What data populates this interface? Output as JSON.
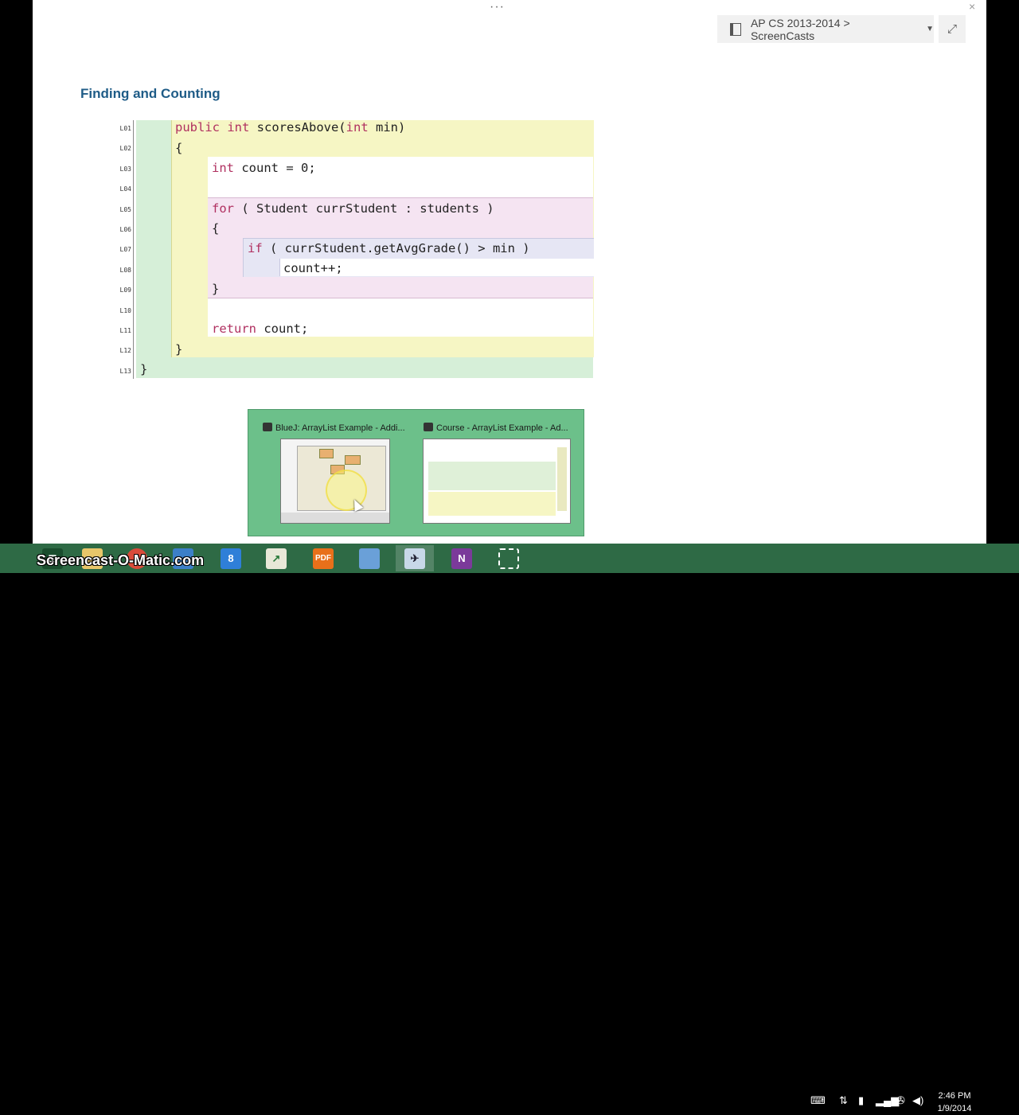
{
  "topbar": {
    "more": "···",
    "close": "×",
    "breadcrumb": "AP CS 2013-2014 > ScreenCasts",
    "fullscreen": "⤢"
  },
  "page": {
    "title": "Finding and Counting"
  },
  "code": {
    "line_numbers": [
      "L01",
      "L02",
      "L03",
      "L04",
      "L05",
      "L06",
      "L07",
      "L08",
      "L09",
      "L10",
      "L11",
      "L12",
      "L13"
    ],
    "lines": [
      {
        "kw": "public int",
        "text": " scoresAbove(",
        "kw2": "int",
        "text2": " min)"
      },
      {
        "text": "{"
      },
      {
        "kw": "int",
        "text": " count = 0;"
      },
      {
        "text": ""
      },
      {
        "kw": "for",
        "text": " ( Student currStudent : students )"
      },
      {
        "text": "{"
      },
      {
        "kw": "if",
        "text": " ( currStudent.getAvgGrade() > min )"
      },
      {
        "text": "count++;"
      },
      {
        "text": "}"
      },
      {
        "text": ""
      },
      {
        "kw": "return",
        "text": " count;"
      },
      {
        "text": "}"
      },
      {
        "text": "}"
      }
    ]
  },
  "popup": {
    "items": [
      {
        "title": "BlueJ:  ArrayList Example - Addi..."
      },
      {
        "title": "Course - ArrayList Example - Ad..."
      }
    ]
  },
  "watermark": "Screencast-O-Matic.com",
  "taskbar": {
    "items": [
      "start",
      "file-explorer",
      "chrome",
      "remote-desktop",
      "calendar",
      "project",
      "pdf",
      "network",
      "bluej",
      "onenote",
      "snipping"
    ],
    "calendar_day": "8",
    "onenote_letter": "N",
    "pdf_label": "PDF"
  },
  "clock": {
    "time": "2:46 PM",
    "date": "1/9/2014"
  }
}
